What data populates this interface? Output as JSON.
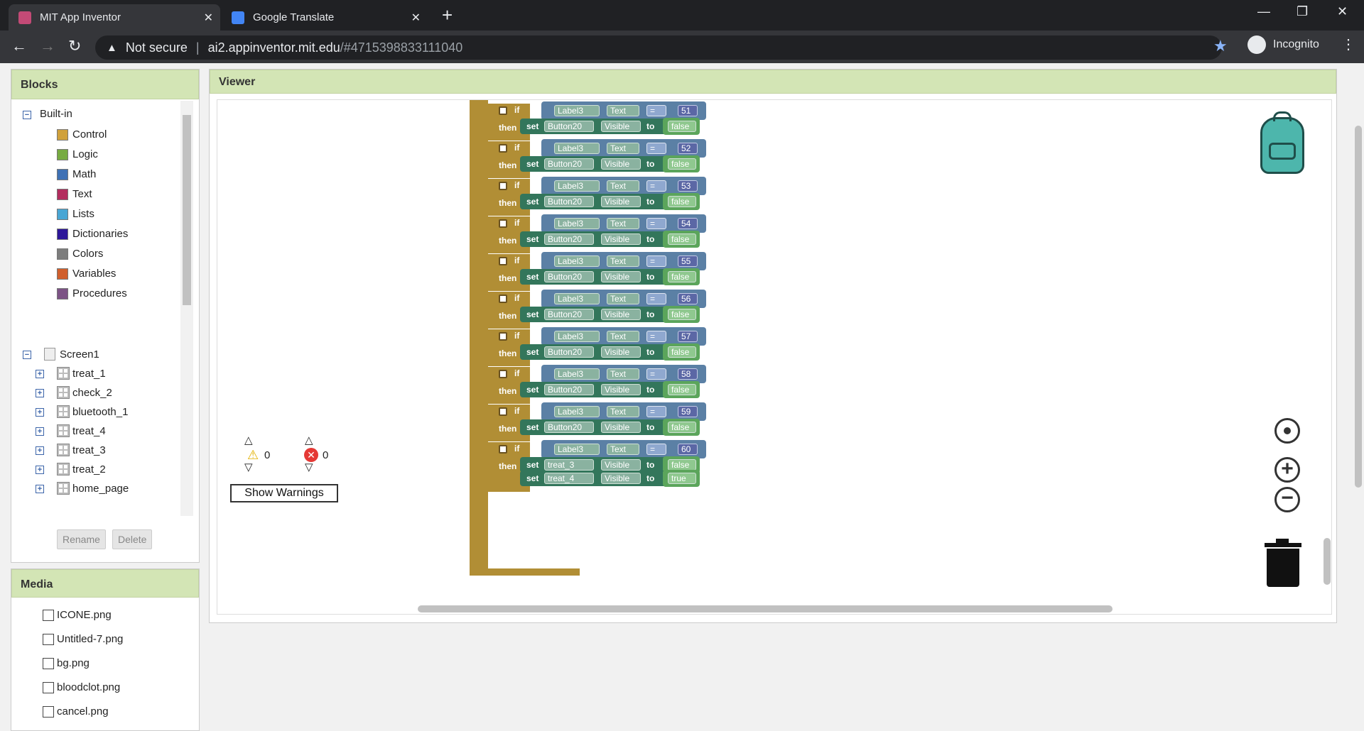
{
  "browser": {
    "tabs": [
      {
        "title": "MIT App Inventor"
      },
      {
        "title": "Google Translate"
      }
    ],
    "url_security": "Not secure",
    "url_host": "ai2.appinventor.mit.edu",
    "url_path": "/#4715398833111040",
    "profile": "Incognito"
  },
  "blocks_panel": {
    "title": "Blocks",
    "builtin_label": "Built-in",
    "builtins": [
      {
        "label": "Control",
        "color": "#d0a13b"
      },
      {
        "label": "Logic",
        "color": "#77ab41"
      },
      {
        "label": "Math",
        "color": "#3f71b5"
      },
      {
        "label": "Text",
        "color": "#b32d5e"
      },
      {
        "label": "Lists",
        "color": "#49a6d4"
      },
      {
        "label": "Dictionaries",
        "color": "#2d1799"
      },
      {
        "label": "Colors",
        "color": "#7d7d7d"
      },
      {
        "label": "Variables",
        "color": "#d05f2d"
      },
      {
        "label": "Procedures",
        "color": "#7c5385"
      }
    ],
    "screen_label": "Screen1",
    "components": [
      "treat_1",
      "check_2",
      "bluetooth_1",
      "treat_4",
      "treat_3",
      "treat_2",
      "home_page"
    ],
    "rename_label": "Rename",
    "delete_label": "Delete"
  },
  "media_panel": {
    "title": "Media",
    "files": [
      "ICONE.png",
      "Untitled-7.png",
      "bg.png",
      "bloodclot.png",
      "cancel.png"
    ]
  },
  "viewer": {
    "title": "Viewer",
    "warnings_count": "0",
    "errors_count": "0",
    "show_warnings_label": "Show Warnings"
  },
  "code": {
    "kw_if": "if",
    "kw_then": "then",
    "kw_set": "set",
    "kw_to": "to",
    "rows": [
      {
        "label": "Label3",
        "prop": "Text",
        "op": "=",
        "value": "51",
        "target": "Button20",
        "target_prop": "Visible",
        "result": "false"
      },
      {
        "label": "Label3",
        "prop": "Text",
        "op": "=",
        "value": "52",
        "target": "Button20",
        "target_prop": "Visible",
        "result": "false"
      },
      {
        "label": "Label3",
        "prop": "Text",
        "op": "=",
        "value": "53",
        "target": "Button20",
        "target_prop": "Visible",
        "result": "false"
      },
      {
        "label": "Label3",
        "prop": "Text",
        "op": "=",
        "value": "54",
        "target": "Button20",
        "target_prop": "Visible",
        "result": "false"
      },
      {
        "label": "Label3",
        "prop": "Text",
        "op": "=",
        "value": "55",
        "target": "Button20",
        "target_prop": "Visible",
        "result": "false"
      },
      {
        "label": "Label3",
        "prop": "Text",
        "op": "=",
        "value": "56",
        "target": "Button20",
        "target_prop": "Visible",
        "result": "false"
      },
      {
        "label": "Label3",
        "prop": "Text",
        "op": "=",
        "value": "57",
        "target": "Button20",
        "target_prop": "Visible",
        "result": "false"
      },
      {
        "label": "Label3",
        "prop": "Text",
        "op": "=",
        "value": "58",
        "target": "Button20",
        "target_prop": "Visible",
        "result": "false"
      },
      {
        "label": "Label3",
        "prop": "Text",
        "op": "=",
        "value": "59",
        "target": "Button20",
        "target_prop": "Visible",
        "result": "false"
      }
    ],
    "last": {
      "label": "Label3",
      "prop": "Text",
      "op": "=",
      "value": "60",
      "sets": [
        {
          "target": "treat_3",
          "prop": "Visible",
          "result": "false"
        },
        {
          "target": "treat_4",
          "prop": "Visible",
          "result": "true"
        }
      ]
    }
  }
}
